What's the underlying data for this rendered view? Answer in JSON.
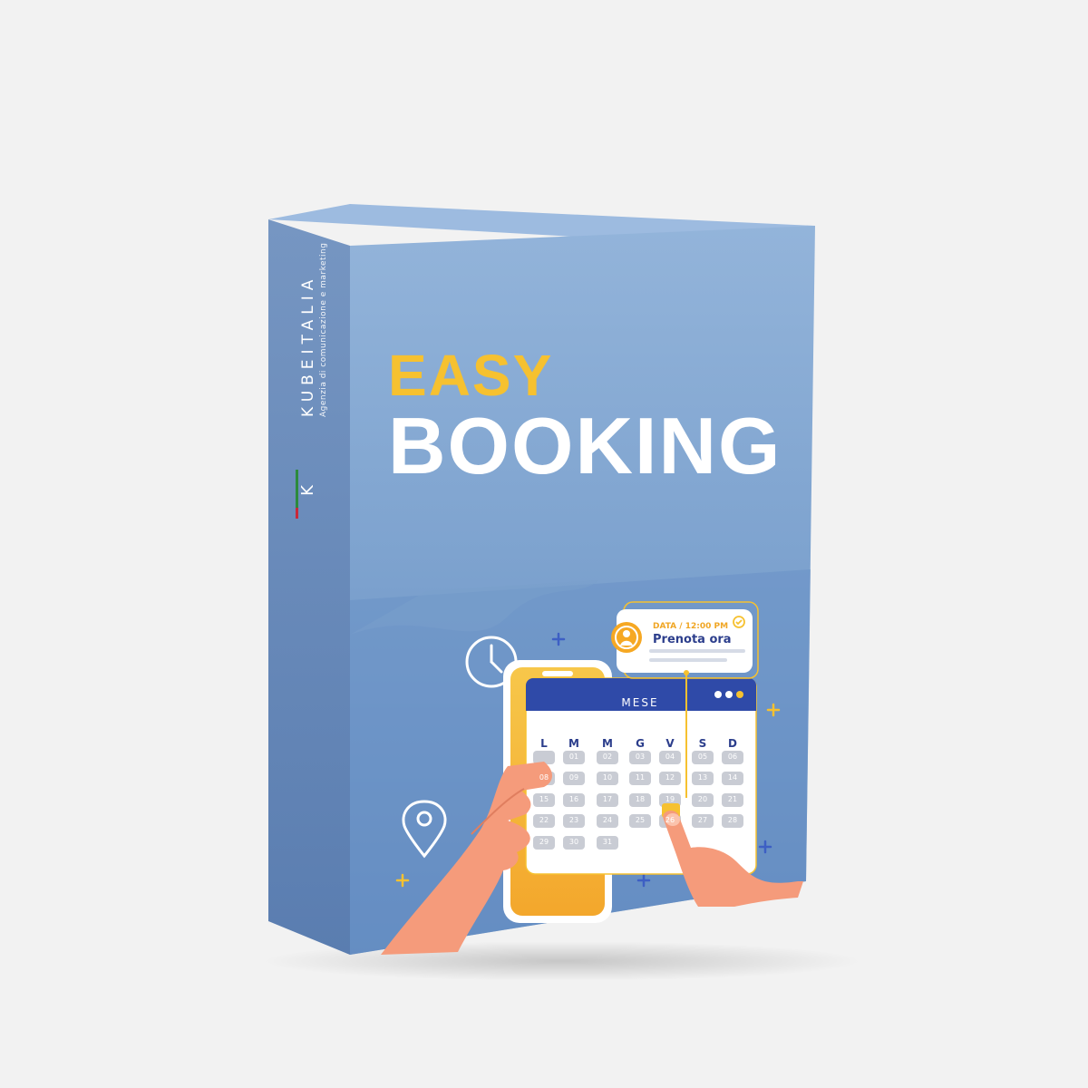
{
  "brand": {
    "name": "KUBEITALIA",
    "tagline": "Agenzia di comunicazione e marketing",
    "logo_letter": "K"
  },
  "title": {
    "line1": "EASY",
    "line2": "BOOKING"
  },
  "illustration": {
    "notification": {
      "label": "DATA / 12:00 PM",
      "title": "Prenota ora"
    },
    "calendar": {
      "month_label": "MESE",
      "weekdays": [
        "L",
        "M",
        "M",
        "G",
        "V",
        "S",
        "D"
      ],
      "rows": [
        [
          "",
          "01",
          "02",
          "03",
          "04",
          "05",
          "06",
          "07"
        ],
        [
          "08",
          "09",
          "10",
          "11",
          "12",
          "13",
          "14"
        ],
        [
          "15",
          "16",
          "17",
          "18",
          "19",
          "20",
          "21"
        ],
        [
          "22",
          "23",
          "24",
          "25",
          "26",
          "27",
          "28"
        ],
        [
          "29",
          "30",
          "31"
        ]
      ]
    },
    "icons": [
      "clock-icon",
      "location-pin-icon",
      "user-icon",
      "check-icon",
      "plus-icon"
    ]
  },
  "colors": {
    "box_blue": "#6e97c6",
    "box_blue_light": "#93b6db",
    "title_yellow": "#f6c130",
    "calendar_header": "#2f4aa8",
    "phone_yellow": "#f5b93a"
  }
}
